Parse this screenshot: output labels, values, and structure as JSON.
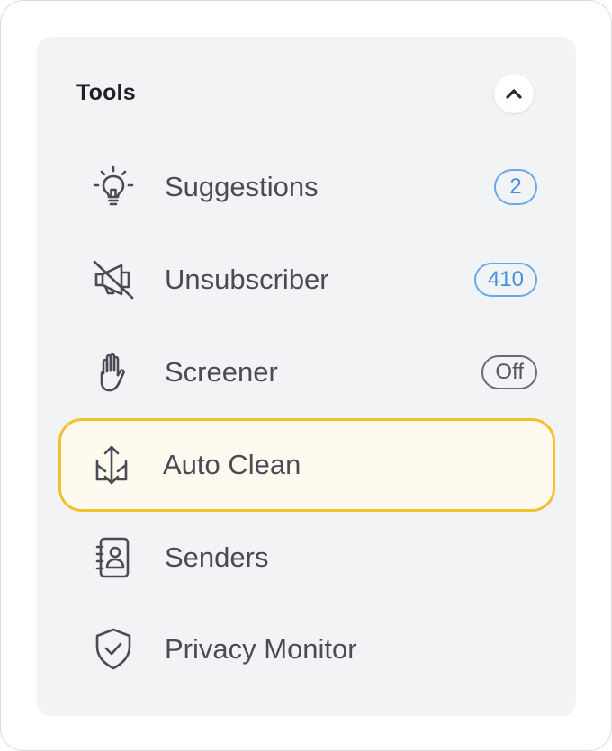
{
  "tools_panel": {
    "title": "Tools",
    "collapse_icon": "chevron-up-icon",
    "items": [
      {
        "id": "suggestions",
        "label": "Suggestions",
        "icon": "lightbulb-icon",
        "badge": "2",
        "badge_style": "blue"
      },
      {
        "id": "unsubscriber",
        "label": "Unsubscriber",
        "icon": "muted-megaphone-icon",
        "badge": "410",
        "badge_style": "blue"
      },
      {
        "id": "screener",
        "label": "Screener",
        "icon": "hand-stop-icon",
        "badge": "Off",
        "badge_style": "gray"
      },
      {
        "id": "auto-clean",
        "label": "Auto Clean",
        "icon": "arrows-in-out-icon",
        "active": true
      },
      {
        "id": "senders",
        "label": "Senders",
        "icon": "contact-book-icon"
      },
      {
        "id": "privacy-monitor",
        "label": "Privacy Monitor",
        "icon": "shield-check-icon"
      }
    ]
  },
  "colors": {
    "panel_bg": "#f2f3f5",
    "active_bg": "#fffaf0",
    "active_border": "#f2c12e",
    "badge_blue": "#4591e0",
    "badge_gray": "#55565e",
    "text": "#4a4b55"
  }
}
